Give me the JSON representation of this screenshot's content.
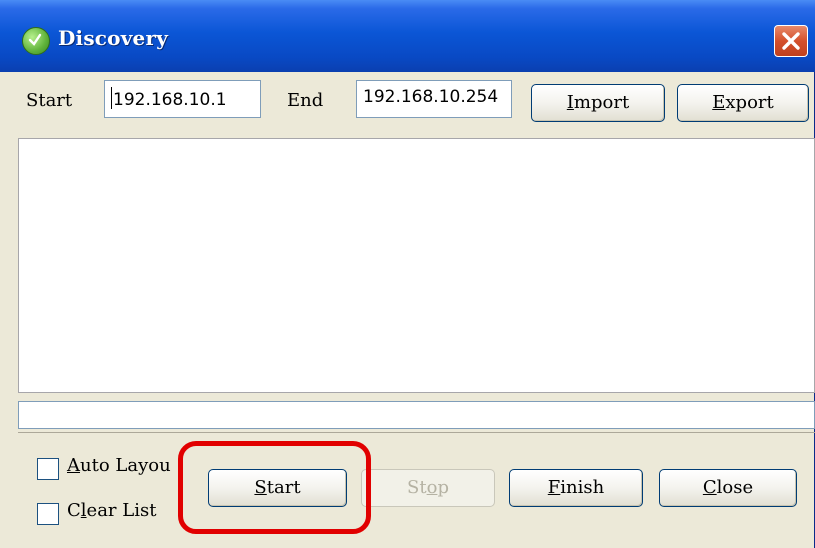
{
  "window": {
    "title": "Discovery",
    "close_glyph": "✕"
  },
  "range": {
    "start_label": "Start",
    "start_value": "192.168.10.1",
    "end_label": "End",
    "end_value": "192.168.10.254"
  },
  "toolbar": {
    "import_label": {
      "u": "I",
      "rest": "mport"
    },
    "export_label": {
      "u": "E",
      "rest": "xport"
    }
  },
  "results": {
    "rows": [],
    "status_text": ""
  },
  "options": {
    "auto_layout": {
      "label_pre": "",
      "u": "A",
      "rest": "uto Layou",
      "checked": false
    },
    "clear_list": {
      "label_pre": "C",
      "u": "l",
      "rest": "ear List",
      "checked": false
    }
  },
  "actions": {
    "start": {
      "pre": "",
      "u": "S",
      "rest": "tart",
      "enabled": true
    },
    "stop": {
      "pre": "St",
      "u": "o",
      "rest": "p",
      "enabled": false
    },
    "finish": {
      "pre": "",
      "u": "F",
      "rest": "inish",
      "enabled": true
    },
    "close": {
      "pre": "",
      "u": "C",
      "rest": "lose",
      "enabled": true
    }
  },
  "colors": {
    "highlight": "#E10000",
    "titlebar": "#0B56D6",
    "window_bg": "#ECE9D8"
  },
  "icons": {
    "app": "discovery-app-icon",
    "close": "close-icon"
  }
}
